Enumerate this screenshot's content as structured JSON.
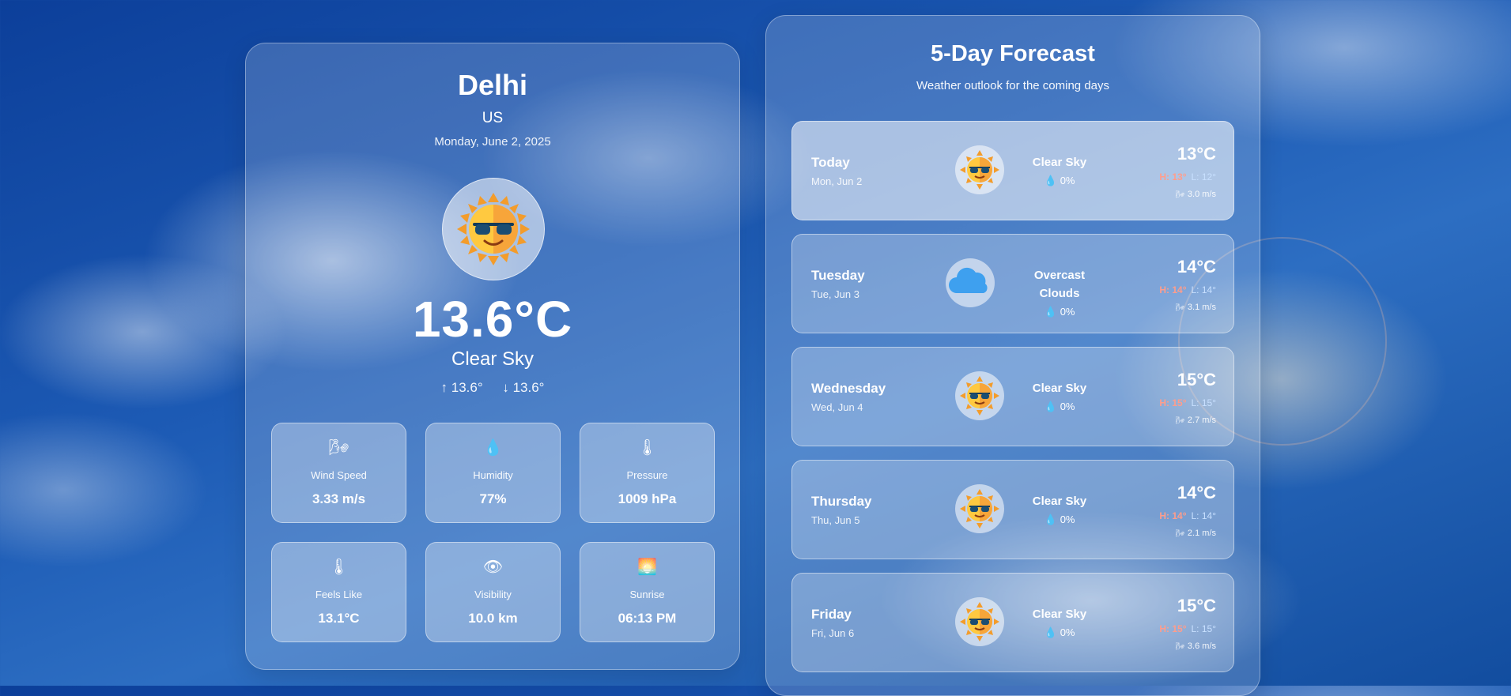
{
  "current": {
    "city": "Delhi",
    "country": "US",
    "date": "Monday, June 2, 2025",
    "icon": "sun-with-sunglasses-icon",
    "temperature": "13.6°C",
    "condition": "Clear Sky",
    "high": "13.6°",
    "low": "13.6°",
    "arrow_up": "↑",
    "arrow_down": "↓",
    "stats": [
      {
        "icon": "wind-icon",
        "glyph": "🌬",
        "label": "Wind Speed",
        "value": "3.33 m/s"
      },
      {
        "icon": "humidity-drop-icon",
        "glyph": "💧",
        "label": "Humidity",
        "value": "77%"
      },
      {
        "icon": "thermometer-icon",
        "glyph": "🌡",
        "label": "Pressure",
        "value": "1009 hPa"
      },
      {
        "icon": "thermometer-icon",
        "glyph": "🌡",
        "label": "Feels Like",
        "value": "13.1°C"
      },
      {
        "icon": "eye-icon",
        "glyph": "👁",
        "label": "Visibility",
        "value": "10.0 km"
      },
      {
        "icon": "sunrise-icon",
        "glyph": "🌅",
        "label": "Sunrise",
        "value": "06:13 PM"
      }
    ]
  },
  "forecast": {
    "title": "5-Day Forecast",
    "subtitle": "Weather outlook for the coming days",
    "days": [
      {
        "name": "Today",
        "date": "Mon, Jun 2",
        "icon": "sun-icon",
        "condition": "Clear Sky",
        "precip": "0%",
        "temp": "13°C",
        "high": "H: 13°",
        "low": "L: 12°",
        "wind": "3.0 m/s"
      },
      {
        "name": "Tuesday",
        "date": "Tue, Jun 3",
        "icon": "cloud-icon",
        "condition": "Overcast Clouds",
        "precip": "0%",
        "temp": "14°C",
        "high": "H: 14°",
        "low": "L: 14°",
        "wind": "3.1 m/s"
      },
      {
        "name": "Wednesday",
        "date": "Wed, Jun 4",
        "icon": "sun-icon",
        "condition": "Clear Sky",
        "precip": "0%",
        "temp": "15°C",
        "high": "H: 15°",
        "low": "L: 15°",
        "wind": "2.7 m/s"
      },
      {
        "name": "Thursday",
        "date": "Thu, Jun 5",
        "icon": "sun-icon",
        "condition": "Clear Sky",
        "precip": "0%",
        "temp": "14°C",
        "high": "H: 14°",
        "low": "L: 14°",
        "wind": "2.1 m/s"
      },
      {
        "name": "Friday",
        "date": "Fri, Jun 6",
        "icon": "sun-icon",
        "condition": "Clear Sky",
        "precip": "0%",
        "temp": "15°C",
        "high": "H: 15°",
        "low": "L: 15°",
        "wind": "3.6 m/s"
      }
    ]
  },
  "colors": {
    "accent_high": "#ff9d8c",
    "accent_low": "#c8e0ff",
    "drop": "#5cb3ff"
  }
}
